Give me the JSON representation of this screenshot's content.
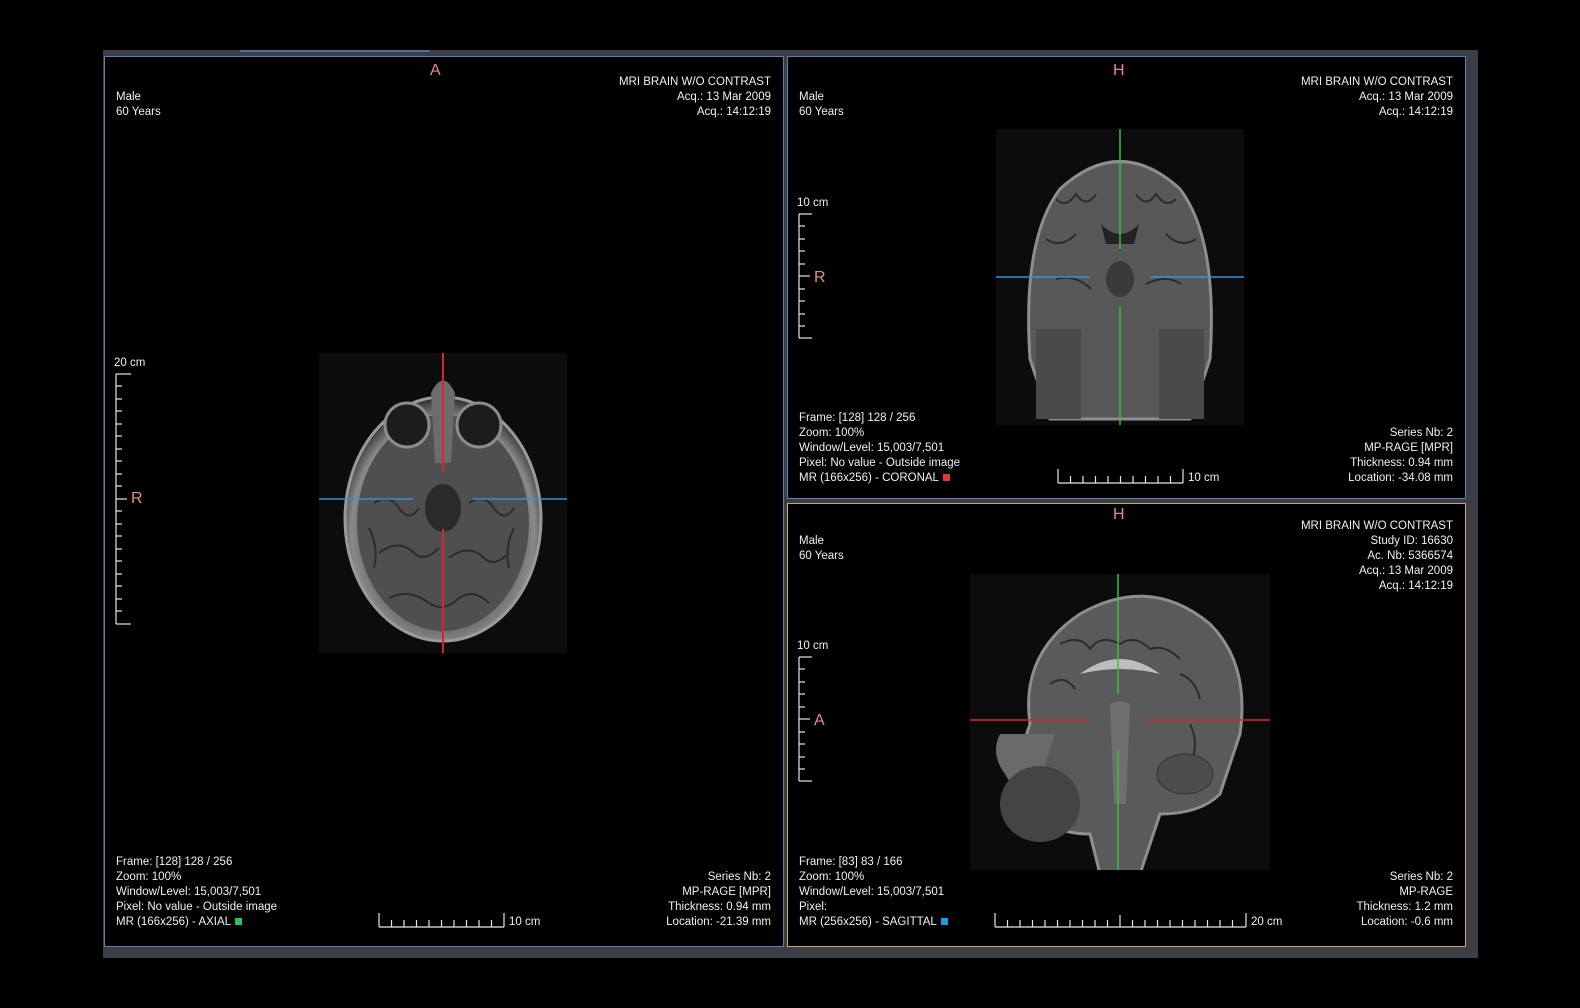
{
  "colors": {
    "axial_marker": "#22c55e",
    "coronal_marker": "#e53935",
    "sagittal_marker": "#1e9be0",
    "orientation": "#e88a86",
    "crosshair_red": "#d6262a",
    "crosshair_blue": "#3a8fd9",
    "crosshair_green": "#3bbf3b"
  },
  "axial": {
    "orient_top": "A",
    "orient_left": "R",
    "patient_sex": "Male",
    "patient_age": "60 Years",
    "study": "MRI BRAIN W/O CONTRAST",
    "acq_date": "Acq.: 13 Mar 2009",
    "acq_time": "Acq.: 14:12:19",
    "frame": "Frame: [128] 128 / 256",
    "zoom": "Zoom: 100%",
    "window_level": "Window/Level: 15,003/7,501",
    "pixel": "Pixel: No value - Outside image",
    "series_desc": "MR (166x256) - AXIAL",
    "series_nb": "Series Nb: 2",
    "protocol": "MP-RAGE [MPR]",
    "thickness": "Thickness: 0.94 mm",
    "location": "Location: -21.39 mm",
    "vscale_label": "20 cm",
    "hscale_label": "10 cm"
  },
  "coronal": {
    "orient_top": "H",
    "orient_left": "R",
    "patient_sex": "Male",
    "patient_age": "60 Years",
    "study": "MRI BRAIN W/O CONTRAST",
    "acq_date": "Acq.: 13 Mar 2009",
    "acq_time": "Acq.: 14:12:19",
    "frame": "Frame: [128] 128 / 256",
    "zoom": "Zoom: 100%",
    "window_level": "Window/Level: 15,003/7,501",
    "pixel": "Pixel: No value - Outside image",
    "series_desc": "MR (166x256) - CORONAL",
    "series_nb": "Series Nb: 2",
    "protocol": "MP-RAGE [MPR]",
    "thickness": "Thickness: 0.94 mm",
    "location": "Location: -34.08 mm",
    "vscale_label": "10 cm",
    "hscale_label": "10 cm"
  },
  "sagittal": {
    "orient_top": "H",
    "orient_left": "A",
    "patient_sex": "Male",
    "patient_age": "60 Years",
    "study": "MRI BRAIN W/O CONTRAST",
    "study_id": "Study ID: 16630",
    "ac_nb": "Ac. Nb: 5366574",
    "acq_date": "Acq.: 13 Mar 2009",
    "acq_time": "Acq.: 14:12:19",
    "frame": "Frame: [83] 83 / 166",
    "zoom": "Zoom: 100%",
    "window_level": "Window/Level: 15,003/7,501",
    "pixel": "Pixel:",
    "series_desc": "MR (256x256) - SAGITTAL",
    "series_nb": "Series Nb: 2",
    "protocol": "MP-RAGE",
    "thickness": "Thickness: 1.2 mm",
    "location": "Location: -0.6 mm",
    "vscale_label": "10 cm",
    "hscale_label": "20 cm"
  }
}
